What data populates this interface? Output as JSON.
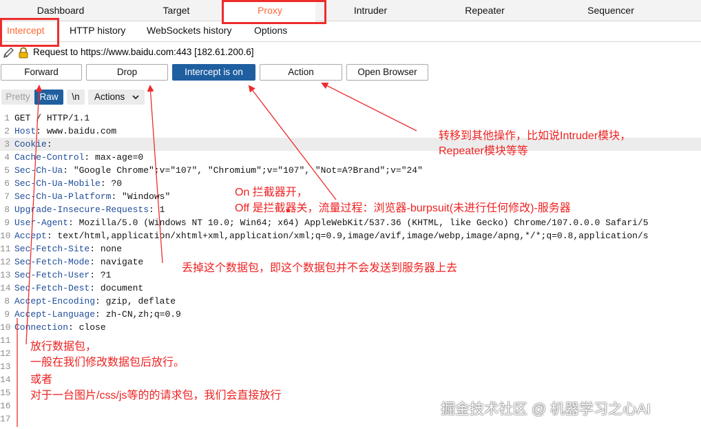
{
  "top_tabs": [
    "Dashboard",
    "Target",
    "Proxy",
    "Intruder",
    "Repeater",
    "Sequencer"
  ],
  "sub_tabs": [
    "Intercept",
    "HTTP history",
    "WebSockets history",
    "Options"
  ],
  "request": {
    "text": "Request to https://www.baidu.com:443  [182.61.200.6]"
  },
  "buttons": {
    "forward": "Forward",
    "drop": "Drop",
    "intercept": "Intercept is on",
    "action": "Action",
    "open_browser": "Open Browser"
  },
  "editor_toolbar": {
    "pretty": "Pretty",
    "raw": "Raw",
    "newline": "\\n",
    "actions": "Actions"
  },
  "lines": [
    {
      "n": "1",
      "name": "GET ",
      "rest": "/ HTTP/1.1"
    },
    {
      "n": "2",
      "name": "Host",
      "rest": ": www.baidu.com"
    },
    {
      "n": "3",
      "name": "Cookie",
      "rest": ":"
    },
    {
      "n": "4",
      "name": "Cache-Control",
      "rest": ": max-age=0"
    },
    {
      "n": "5",
      "name": "Sec-Ch-Ua",
      "rest": ": \"Google Chrome\";v=\"107\", \"Chromium\";v=\"107\", \"Not=A?Brand\";v=\"24\""
    },
    {
      "n": "6",
      "name": "Sec-Ch-Ua-Mobile",
      "rest": ": ?0"
    },
    {
      "n": "7",
      "name": "Sec-Ch-Ua-Platform",
      "rest": ": \"Windows\""
    },
    {
      "n": "8",
      "name": "Upgrade-Insecure-Requests",
      "rest": ": 1"
    },
    {
      "n": "9",
      "name": "User-Agent",
      "rest": ": Mozilla/5.0 (Windows NT 10.0; Win64; x64) AppleWebKit/537.36 (KHTML, like Gecko) Chrome/107.0.0.0 Safari/5"
    },
    {
      "n": "10",
      "name": "Accept",
      "rest": ": text/html,application/xhtml+xml,application/xml;q=0.9,image/avif,image/webp,image/apng,*/*;q=0.8,application/s"
    },
    {
      "n": "11",
      "name": "Sec-Fetch-Site",
      "rest": ": none"
    },
    {
      "n": "12",
      "name": "Sec-Fetch-Mode",
      "rest": ": navigate"
    },
    {
      "n": "13",
      "name": "Sec-Fetch-User",
      "rest": ": ?1"
    },
    {
      "n": "14",
      "name": "Sec-Fetch-Dest",
      "rest": ": document"
    },
    {
      "n": "8",
      "name": "Accept-Encoding",
      "rest": ": gzip, deflate"
    },
    {
      "n": "9",
      "name": "Accept-Language",
      "rest": ": zh-CN,zh;q=0.9"
    },
    {
      "n": "10",
      "name": "Connection",
      "rest": ": close"
    },
    {
      "n": "11",
      "name": "",
      "rest": ""
    },
    {
      "n": "12",
      "name": "",
      "rest": ""
    },
    {
      "n": "13",
      "name": "",
      "rest": ""
    },
    {
      "n": "14",
      "name": "",
      "rest": ""
    },
    {
      "n": "15",
      "name": "",
      "rest": ""
    },
    {
      "n": "16",
      "name": "",
      "rest": ""
    },
    {
      "n": "17",
      "name": "",
      "rest": ""
    }
  ],
  "annotations": {
    "action_note_1": "转移到其他操作，比如说Intruder模块，",
    "action_note_2": "Repeater模块等等",
    "intercept_note_1": "On 拦截器开，",
    "intercept_note_2": "Off 是拦截器关，流量过程：浏览器-burpsuit(未进行任何修改)-服务器",
    "drop_note": "丢掉这个数据包，即这个数据包并不会发送到服务器上去",
    "forward_note_1": "放行数据包，",
    "forward_note_2": "一般在我们修改数据包后放行。",
    "forward_note_3": "或者",
    "forward_note_4": "对于一台图片/css/js等的的请求包，我们会直接放行"
  },
  "watermark": "掘金技术社区 @ 机器学习之心AI",
  "colors": {
    "accent": "#ff6633",
    "primary_button": "#1f5fa0",
    "annotation": "#ee2c2c",
    "header_name": "#1f4d9a"
  }
}
